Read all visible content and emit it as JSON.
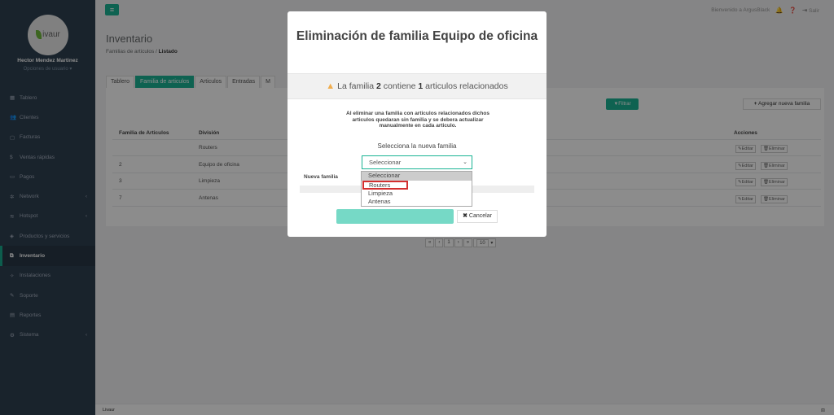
{
  "sidebar": {
    "logo_text": "ivaur",
    "user_name": "Hector Mendez Martinez",
    "user_options": "Opciones de usuario",
    "items": [
      {
        "label": "Tablero",
        "icon": "dashboard-icon",
        "glyph": "▦"
      },
      {
        "label": "Clientes",
        "icon": "users-icon",
        "glyph": "👥"
      },
      {
        "label": "Facturas",
        "icon": "file-icon",
        "glyph": "▢"
      },
      {
        "label": "Ventas rápidas",
        "icon": "dollar-icon",
        "glyph": "$"
      },
      {
        "label": "Pagos",
        "icon": "money-icon",
        "glyph": "▭"
      },
      {
        "label": "Network",
        "icon": "network-icon",
        "glyph": "✲"
      },
      {
        "label": "Hotspot",
        "icon": "wifi-icon",
        "glyph": "≋"
      },
      {
        "label": "Productos y servicios",
        "icon": "tag-icon",
        "glyph": "◈"
      },
      {
        "label": "Inventario",
        "icon": "inventory-icon",
        "glyph": "⧉"
      },
      {
        "label": "Instalaciones",
        "icon": "tools-icon",
        "glyph": "✧"
      },
      {
        "label": "Soporte",
        "icon": "wrench-icon",
        "glyph": "✎"
      },
      {
        "label": "Reportes",
        "icon": "report-icon",
        "glyph": "▤"
      },
      {
        "label": "Sistema",
        "icon": "cogs-icon",
        "glyph": "⚙"
      }
    ]
  },
  "topbar": {
    "welcome": "Bienvenido a ArgusBlack",
    "logout": "Salir"
  },
  "page": {
    "title": "Inventario",
    "breadcrumb_parent": "Familias de articulos",
    "breadcrumb_current": "Listado"
  },
  "tabs": [
    "Tablero",
    "Familia de articulos",
    "Articulos",
    "Entradas",
    "M"
  ],
  "toolbar": {
    "filter_label": "Filtrar",
    "add_label": "Agregar nueva familia"
  },
  "table": {
    "headers": [
      "Familia de Articulos",
      "División",
      "Acciones"
    ],
    "rows": [
      {
        "id": "",
        "division": "Routers"
      },
      {
        "id": "2",
        "division": "Equipo de oficina"
      },
      {
        "id": "3",
        "division": "Limpieza"
      },
      {
        "id": "7",
        "division": "Antenas"
      }
    ],
    "edit_label": "Editar",
    "delete_label": "Eliminar"
  },
  "pager": {
    "first": "«",
    "prev": "‹",
    "page": "1",
    "next": "›",
    "last": "»",
    "per_page": "10"
  },
  "footer": {
    "text": "Livaur"
  },
  "modal": {
    "title": "Eliminación de familia Equipo de oficina",
    "warning_prefix": "La familia",
    "warning_family_id": "2",
    "warning_mid": "contiene",
    "warning_count": "1",
    "warning_suffix": "articulos relacionados",
    "description": "Al eliminar una familia con articulos relacionados dichos articulos quedaran sin familia y se debera actualizar manualmente en cada articulo.",
    "select_label": "Selecciona la nueva familia",
    "select_value": "Seleccionar",
    "options": [
      "Seleccionar",
      "Routers",
      "Limpieza",
      "Antenas"
    ],
    "nueva_familia_label": "Nueva familia",
    "cancel_label": "Cancelar"
  }
}
